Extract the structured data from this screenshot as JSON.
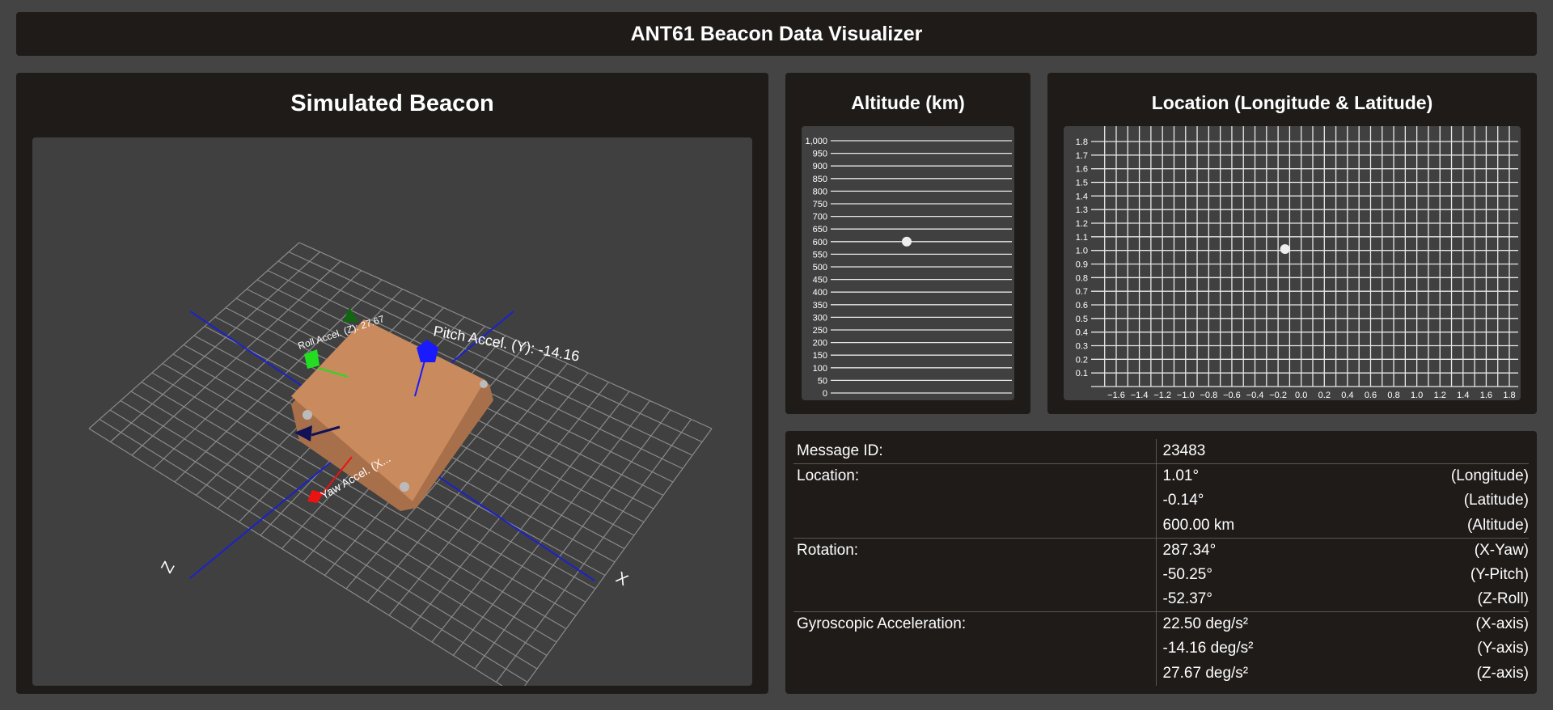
{
  "app": {
    "title": "ANT61 Beacon Data Visualizer"
  },
  "beacon": {
    "title": "Simulated Beacon",
    "axis_labels": {
      "x": "X",
      "z": "Z"
    },
    "arrow_labels": {
      "pitch": "Pitch Accel. (Y): -14.16",
      "roll": "Roll Accel. (Z): 27.67",
      "yaw": "Yaw Accel. (X..."
    },
    "colors": {
      "device": "#c98a5e",
      "pitch": "#1a1aff",
      "roll": "#22dd22",
      "yaw": "#ee1111",
      "axis": "#1a22cc"
    }
  },
  "altitude_chart": {
    "title": "Altitude (km)",
    "y_ticks": [
      "1,000",
      "950",
      "900",
      "850",
      "800",
      "750",
      "700",
      "650",
      "600",
      "550",
      "500",
      "450",
      "400",
      "350",
      "300",
      "250",
      "200",
      "150",
      "100",
      "50",
      "0"
    ]
  },
  "location_chart": {
    "title": "Location (Longitude & Latitude)",
    "y_ticks": [
      "1.8",
      "1.7",
      "1.6",
      "1.5",
      "1.4",
      "1.3",
      "1.2",
      "1.1",
      "1.0",
      "0.9",
      "0.8",
      "0.7",
      "0.6",
      "0.5",
      "0.4",
      "0.3",
      "0.2",
      "0.1"
    ],
    "x_ticks": [
      "−1.6",
      "−1.4",
      "−1.2",
      "−1.0",
      "−0.8",
      "−0.6",
      "−0.4",
      "−0.2",
      "0.0",
      "0.2",
      "0.4",
      "0.6",
      "0.8",
      "1.0",
      "1.2",
      "1.4",
      "1.6",
      "1.8"
    ]
  },
  "chart_data": [
    {
      "type": "scatter",
      "title": "Altitude (km)",
      "ylim": [
        0,
        1000
      ],
      "points": [
        {
          "y": 600
        }
      ]
    },
    {
      "type": "scatter",
      "title": "Location (Longitude & Latitude)",
      "xlim": [
        -1.6,
        1.8
      ],
      "ylim": [
        0,
        1.8
      ],
      "points": [
        {
          "x": -0.14,
          "y": 1.01
        }
      ]
    }
  ],
  "data_table": {
    "message_id": {
      "label": "Message ID:",
      "value": "23483"
    },
    "location": {
      "label": "Location:",
      "rows": [
        {
          "value": "1.01°",
          "unit": "(Longitude)"
        },
        {
          "value": "-0.14°",
          "unit": "(Latitude)"
        },
        {
          "value": "600.00 km",
          "unit": "(Altitude)"
        }
      ]
    },
    "rotation": {
      "label": "Rotation:",
      "rows": [
        {
          "value": "287.34°",
          "unit": "(X-Yaw)"
        },
        {
          "value": "-50.25°",
          "unit": "(Y-Pitch)"
        },
        {
          "value": "-52.37°",
          "unit": "(Z-Roll)"
        }
      ]
    },
    "gyro": {
      "label": "Gyroscopic Acceleration:",
      "rows": [
        {
          "value": "22.50 deg/s²",
          "unit": "(X-axis)"
        },
        {
          "value": "-14.16 deg/s²",
          "unit": "(Y-axis)"
        },
        {
          "value": "27.67 deg/s²",
          "unit": "(Z-axis)"
        }
      ]
    }
  }
}
